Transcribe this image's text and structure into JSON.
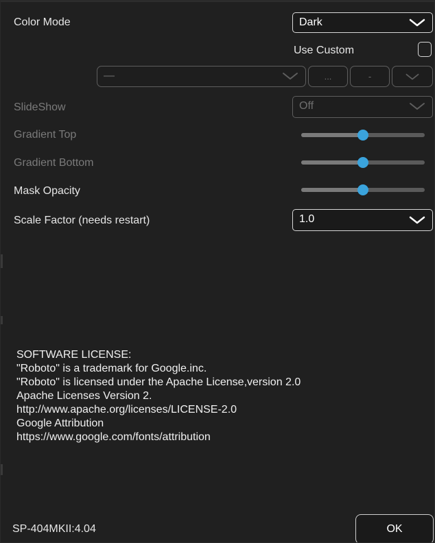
{
  "settings": {
    "color_mode": {
      "label": "Color Mode",
      "value": "Dark"
    },
    "use_custom": {
      "label": "Use Custom",
      "checked": false
    },
    "custom_image": {
      "value": "—",
      "browse_label": "...",
      "minus_label": "-"
    },
    "slideshow": {
      "label": "SlideShow",
      "value": "Off"
    },
    "gradient_top": {
      "label": "Gradient Top",
      "value": 0.5
    },
    "gradient_bottom": {
      "label": "Gradient Bottom",
      "value": 0.5
    },
    "mask_opacity": {
      "label": "Mask Opacity",
      "value": 0.5
    },
    "scale_factor": {
      "label": "Scale Factor (needs restart)",
      "value": "1.0"
    }
  },
  "license": {
    "lines": [
      "SOFTWARE LICENSE:",
      "\"Roboto\" is a trademark for Google.inc.",
      "\"Roboto\" is licensed under the Apache License,version 2.0",
      "Apache Licenses Version 2.",
      "http://www.apache.org/licenses/LICENSE-2.0",
      "Google Attribution",
      "https://www.google.com/fonts/attribution"
    ]
  },
  "footer": {
    "version": "SP-404MKII:4.04",
    "ok_label": "OK"
  },
  "colors": {
    "accent": "#3aa3dc",
    "background": "#202020",
    "text": "#e6e6e6",
    "disabled_text": "#7a7a7a"
  }
}
